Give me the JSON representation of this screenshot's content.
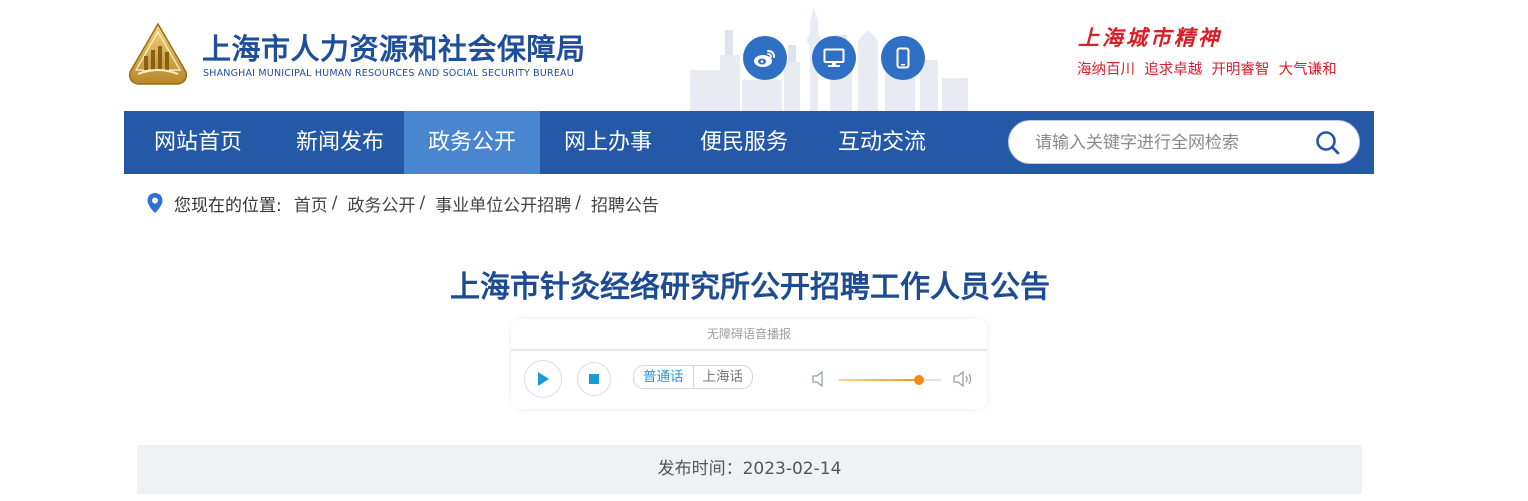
{
  "site": {
    "name_cn": "上海市人力资源和社会保障局",
    "name_en": "SHANGHAI MUNICIPAL HUMAN RESOURCES AND SOCIAL SECURITY BUREAU",
    "spirit_title": "上海城市精神",
    "spirit_slogan": "海纳百川  追求卓越  开明睿智  大气谦和",
    "social_icons": [
      "weibo-icon",
      "desktop-icon",
      "mobile-icon"
    ],
    "colors": {
      "brand_blue": "#2558a7",
      "active_nav": "#4a86d0",
      "title_blue": "#1e4c92",
      "slogan_red": "#d7202a"
    }
  },
  "nav": {
    "items": [
      {
        "label": "网站首页"
      },
      {
        "label": "新闻发布"
      },
      {
        "label": "政务公开",
        "active": true
      },
      {
        "label": "网上办事"
      },
      {
        "label": "便民服务"
      },
      {
        "label": "互动交流"
      }
    ],
    "search_placeholder": "请输入关键字进行全网检索"
  },
  "breadcrumb": {
    "label": "您现在的位置:",
    "items": [
      "首页",
      "政务公开",
      "事业单位公开招聘",
      "招聘公告"
    ],
    "separator": "/"
  },
  "article": {
    "title": "上海市针灸经络研究所公开招聘工作人员公告",
    "publish": "发布时间：2023-02-14"
  },
  "player": {
    "title": "无障碍语音播报",
    "languages": [
      "普通话",
      "上海话"
    ],
    "selected_language": "普通话",
    "volume": 0.78
  }
}
